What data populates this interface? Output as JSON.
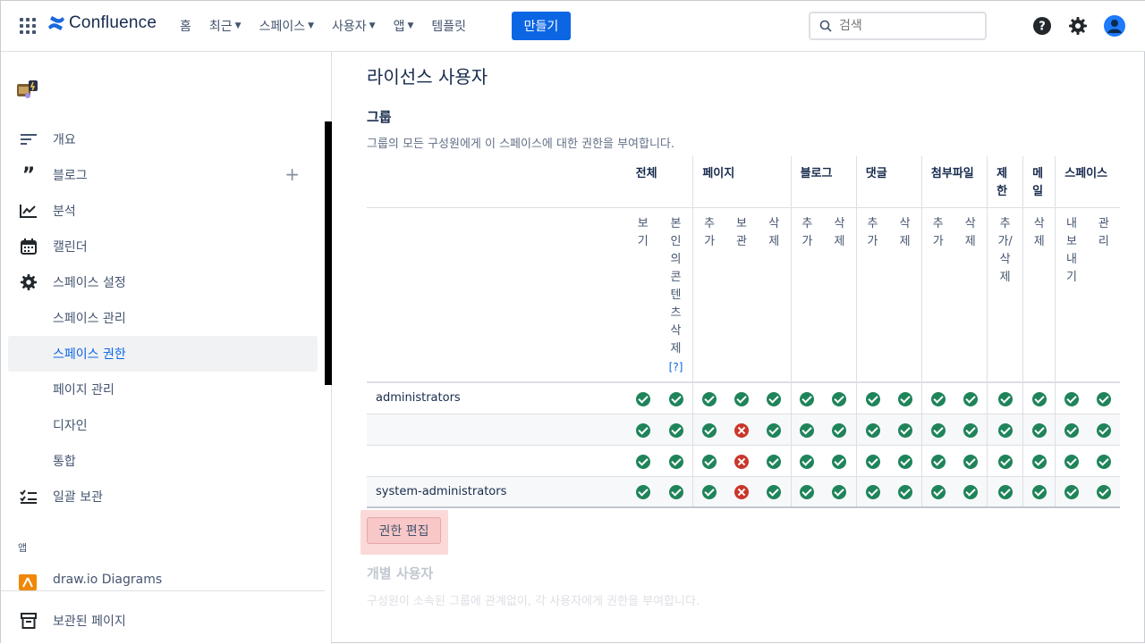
{
  "nav": {
    "brand": "Confluence",
    "items": [
      {
        "label": "홈",
        "dropdown": false
      },
      {
        "label": "최근",
        "dropdown": true
      },
      {
        "label": "스페이스",
        "dropdown": true
      },
      {
        "label": "사용자",
        "dropdown": true
      },
      {
        "label": "앱",
        "dropdown": true
      },
      {
        "label": "템플릿",
        "dropdown": false
      }
    ],
    "create_label": "만들기",
    "search_placeholder": "검색",
    "accent": "#0c66e4"
  },
  "sidebar": {
    "items": [
      {
        "label": "개요",
        "icon": "overview-icon"
      },
      {
        "label": "블로그",
        "icon": "quote-icon"
      },
      {
        "label": "분석",
        "icon": "analytics-icon"
      },
      {
        "label": "캘린더",
        "icon": "calendar-icon"
      },
      {
        "label": "스페이스 설정",
        "icon": "gear-icon"
      },
      {
        "label": "스페이스 관리"
      },
      {
        "label": "스페이스 권한",
        "active": true
      },
      {
        "label": "페이지 관리"
      },
      {
        "label": "디자인"
      },
      {
        "label": "통합"
      },
      {
        "label": "일괄 보관",
        "icon": "bulk-archive-icon"
      }
    ],
    "apps_label": "앱",
    "drawio_label": "draw.io Diagrams",
    "footer_label": "보관된 페이지"
  },
  "main": {
    "page_title": "라이선스 사용자",
    "groups_title": "그룹",
    "groups_desc": "그룹의 모든 구성원에게 이 스페이스에 대한 권한을 부여합니다.",
    "categories": [
      "전체",
      "페이지",
      "블로그",
      "댓글",
      "첨부파일",
      "제한",
      "메일",
      "스페이스"
    ],
    "actions": [
      "보기",
      "본인의콘텐츠삭제",
      "추가",
      "보관",
      "삭제",
      "추가",
      "삭제",
      "추가",
      "삭제",
      "추가",
      "삭제",
      "추가/삭제",
      "삭제",
      "내보내기",
      "관리"
    ],
    "help_marker": "[?]",
    "rows": [
      {
        "name": "administrators",
        "perms": [
          1,
          1,
          1,
          1,
          1,
          1,
          1,
          1,
          1,
          1,
          1,
          1,
          1,
          1,
          1
        ]
      },
      {
        "name": "",
        "perms": [
          1,
          1,
          1,
          0,
          1,
          1,
          1,
          1,
          1,
          1,
          1,
          1,
          1,
          1,
          1
        ]
      },
      {
        "name": "",
        "perms": [
          1,
          1,
          1,
          0,
          1,
          1,
          1,
          1,
          1,
          1,
          1,
          1,
          1,
          1,
          1
        ]
      },
      {
        "name": "system-administrators",
        "perms": [
          1,
          1,
          1,
          0,
          1,
          1,
          1,
          1,
          1,
          1,
          1,
          1,
          1,
          1,
          1
        ]
      }
    ],
    "edit_button": "권한 편집",
    "individual_title": "개별 사용자",
    "individual_desc": "구성원이 소속된 그룹에 관계없이, 각 사용자에게 권한을 부여합니다.",
    "status_colors": {
      "granted": "#1f845a",
      "denied": "#c9372c"
    }
  }
}
